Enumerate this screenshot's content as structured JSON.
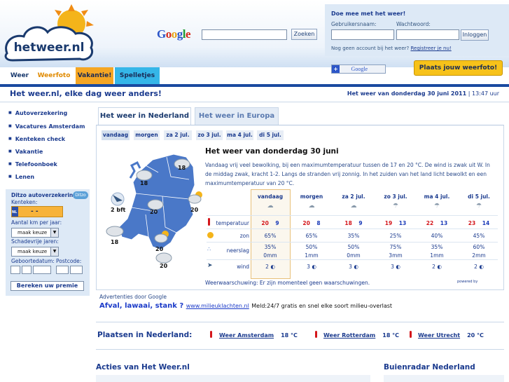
{
  "header": {
    "logo_text": "hetweer.nl",
    "search": {
      "brand": "Google",
      "button": "Zoeken"
    },
    "login": {
      "title": "Doe mee met het weer!",
      "username_label": "Gebruikersnaam:",
      "password_label": "Wachtwoord:",
      "button": "Inloggen",
      "hint": "Nog geen account bij het weer?",
      "register_link": "Registreer je nu!"
    },
    "google_toolbar": "Google",
    "upload_button": "Plaats jouw weerfoto!"
  },
  "nav": {
    "tabs": [
      {
        "label": "Weer",
        "color": "#ffffff"
      },
      {
        "label": "Weerfoto",
        "color": "#ffffff"
      },
      {
        "label": "Vakantie!",
        "color": "#f5a623"
      },
      {
        "label": "Spelletjes",
        "color": "#35b6e8"
      }
    ]
  },
  "page": {
    "slogan": "Het weer.nl, elke dag weer anders!",
    "date_bold": "Het weer van donderdag 30 juni 2011",
    "time": "| 13:47 uur"
  },
  "sidebar": {
    "items": [
      "Autoverzekering",
      "Vacatures Amsterdam",
      "Kenteken check",
      "Vakantie",
      "Telefoonboek",
      "Lenen"
    ],
    "insurance": {
      "title": "Ditzo autoverzekering",
      "kenteken_label": "Kenteken:",
      "plate_country": "NL",
      "plate_text": "-   -",
      "km_label": "Aantal km per jaar:",
      "km_value": "maak keuze",
      "schade_label": "Schadevrije jaren:",
      "schade_value": "maak keuze",
      "birth_label": "Geboortedatum:",
      "postcode_label": "Postcode:",
      "button": "Bereken uw premie",
      "brand": "Ditzo"
    }
  },
  "main": {
    "section_tabs": [
      "Het weer in Nederland",
      "Het weer in Europa"
    ],
    "day_tabs": [
      "vandaag",
      "morgen",
      "za 2 jul.",
      "zo 3 jul.",
      "ma 4 jul.",
      "di 5 jul."
    ],
    "map": {
      "wind": "2 bft",
      "temps": [
        "18",
        "18",
        "20",
        "20",
        "18",
        "20",
        "20"
      ]
    },
    "weather_title": "Het weer van donderdag 30 juni",
    "weather_text": "Vandaag vrij veel bewolking, bij een maximumtemperatuur tussen de 17 en 20 °C. De wind is zwak uit W. In de middag zwak, kracht 1-2. Langs de stranden vrij zonnig. In het zuiden van het land licht bewolkt en een maximumtemperatuur van 20 °C.",
    "forecast": {
      "days": [
        "vandaag",
        "morgen",
        "za 2 jul.",
        "zo 3 jul.",
        "ma 4 jul.",
        "di 5 jul."
      ],
      "row_labels": {
        "temp": "temperatuur",
        "sun": "zon",
        "rain": "neerslag",
        "wind": "wind"
      },
      "tmax": [
        "20",
        "20",
        "18",
        "19",
        "22",
        "23"
      ],
      "tmin": [
        "9",
        "8",
        "9",
        "13",
        "13",
        "14"
      ],
      "sun": [
        "65%",
        "65%",
        "35%",
        "25%",
        "40%",
        "45%"
      ],
      "rain_pct": [
        "35%",
        "50%",
        "50%",
        "75%",
        "35%",
        "60%"
      ],
      "rain_mm": [
        "0mm",
        "1mm",
        "0mm",
        "3mm",
        "1mm",
        "2mm"
      ],
      "wind": [
        "2",
        "3",
        "3",
        "3",
        "2",
        "2"
      ]
    },
    "warning": "Weerwaarschuwing: Er zijn momenteel geen waarschuwingen.",
    "powered": "powered by",
    "ads": {
      "label": "Advertenties door Google",
      "title": "Afval, lawaai, stank ?",
      "url": "www.milieuklachten.nl",
      "text": "Meld:24/7 gratis en snel elke soort milieu-overlast"
    },
    "places": {
      "title": "Plaatsen in Nederland:",
      "list": [
        {
          "name": "Weer Amsterdam",
          "temp": "18 °C"
        },
        {
          "name": "Weer Rotterdam",
          "temp": "18 °C"
        },
        {
          "name": "Weer Utrecht",
          "temp": "20 °C"
        }
      ]
    },
    "footer": {
      "left": "Acties van Het Weer.nl",
      "right": "Buienradar Nederland"
    }
  }
}
